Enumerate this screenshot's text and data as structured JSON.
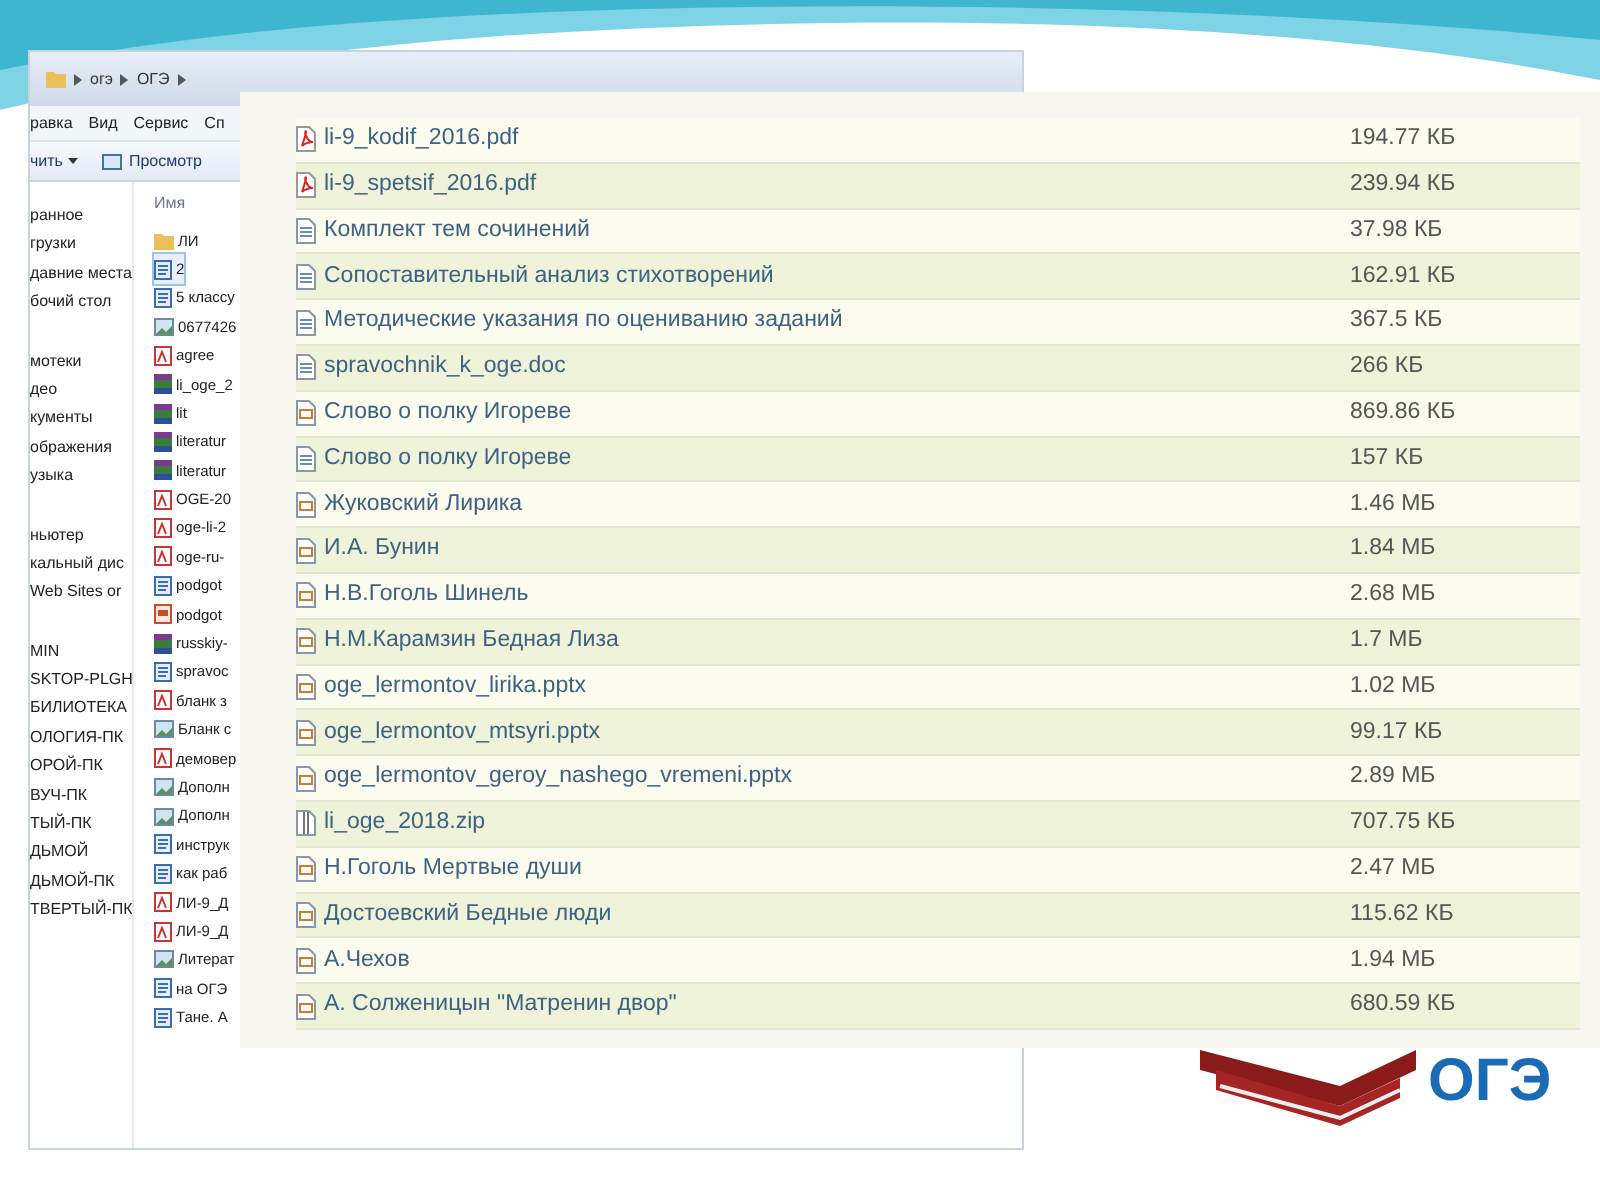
{
  "explorer": {
    "breadcrumbs": [
      "огэ",
      "ОГЭ"
    ],
    "menu": [
      "равка",
      "Вид",
      "Сервис",
      "Сп"
    ],
    "toolbar": [
      {
        "label": "чить",
        "kind": "dropdown"
      },
      {
        "label": "Просмотр",
        "kind": "preview"
      }
    ],
    "nav_groups": [
      [
        "ранное",
        "грузки",
        "давние места",
        "бочий стол"
      ],
      [
        "мотеки",
        "део",
        "кументы",
        "ображения",
        "узыка"
      ],
      [
        "ньютер",
        "кальный дис",
        "Web Sites or"
      ],
      [
        "MIN",
        "SKTOP-PLGH",
        "БИЛИОТЕКА",
        "ОЛОГИЯ-ПК",
        "ОРОЙ-ПК",
        "ВУЧ-ПК",
        "ТЫЙ-ПК",
        "ДЬМОЙ",
        "ДЬМОЙ-ПК",
        "ТВЕРТЫЙ-ПК"
      ]
    ],
    "column_header": "Имя",
    "files": [
      {
        "name": "ЛИ",
        "kind": "folder",
        "selected": false
      },
      {
        "name": "2",
        "kind": "doc",
        "selected": true
      },
      {
        "name": "5 классу",
        "kind": "doc",
        "selected": false
      },
      {
        "name": "0677426",
        "kind": "image",
        "selected": false
      },
      {
        "name": "agree",
        "kind": "pdf",
        "selected": false
      },
      {
        "name": "li_oge_2",
        "kind": "archive",
        "selected": false
      },
      {
        "name": "lit",
        "kind": "archive",
        "selected": false
      },
      {
        "name": "literatur",
        "kind": "archive",
        "selected": false
      },
      {
        "name": "literatur",
        "kind": "archive",
        "selected": false
      },
      {
        "name": "OGE-20",
        "kind": "pdf",
        "selected": false
      },
      {
        "name": "oge-li-2",
        "kind": "pdf",
        "selected": false
      },
      {
        "name": "oge-ru-",
        "kind": "pdf",
        "selected": false
      },
      {
        "name": "podgot",
        "kind": "doc",
        "selected": false
      },
      {
        "name": "podgot",
        "kind": "ppt",
        "selected": false
      },
      {
        "name": "russkiy-",
        "kind": "archive",
        "selected": false
      },
      {
        "name": "spravoc",
        "kind": "doc",
        "selected": false
      },
      {
        "name": "бланк з",
        "kind": "pdf",
        "selected": false
      },
      {
        "name": "Бланк с",
        "kind": "image",
        "selected": false
      },
      {
        "name": "демовер",
        "kind": "pdf",
        "selected": false
      },
      {
        "name": "Дополн",
        "kind": "image",
        "selected": false
      },
      {
        "name": "Дополн",
        "kind": "image",
        "selected": false
      },
      {
        "name": "инструк",
        "kind": "doc",
        "selected": false
      },
      {
        "name": "как раб",
        "kind": "doc",
        "selected": false
      },
      {
        "name": "ЛИ-9_Д",
        "kind": "pdf",
        "selected": false
      },
      {
        "name": "ЛИ-9_Д",
        "kind": "pdf",
        "selected": false
      },
      {
        "name": "Литерат",
        "kind": "image",
        "selected": false
      },
      {
        "name": "на ОГЭ",
        "kind": "doc",
        "selected": false
      },
      {
        "name": "Тане. А",
        "kind": "doc",
        "selected": false
      }
    ]
  },
  "file_table": {
    "rows": [
      {
        "name": "li-9_kodif_2016.pdf",
        "size": "194.77 КБ",
        "kind": "pdf"
      },
      {
        "name": "li-9_spetsif_2016.pdf",
        "size": "239.94 КБ",
        "kind": "pdf"
      },
      {
        "name": "Комплект тем сочинений",
        "size": "37.98 КБ",
        "kind": "doc"
      },
      {
        "name": "Сопоставительный анализ стихотворений",
        "size": "162.91 КБ",
        "kind": "doc"
      },
      {
        "name": "Методические указания по оцениванию заданий",
        "size": "367.5 КБ",
        "kind": "doc"
      },
      {
        "name": "spravochnik_k_oge.doc",
        "size": "266 КБ",
        "kind": "doc"
      },
      {
        "name": "Слово о полку Игореве",
        "size": "869.86 КБ",
        "kind": "ppt"
      },
      {
        "name": "Слово о полку Игореве",
        "size": "157 КБ",
        "kind": "doc"
      },
      {
        "name": "Жуковский Лирика",
        "size": "1.46 МБ",
        "kind": "ppt"
      },
      {
        "name": "И.А. Бунин",
        "size": "1.84 МБ",
        "kind": "ppt"
      },
      {
        "name": "Н.В.Гоголь Шинель",
        "size": "2.68 МБ",
        "kind": "ppt"
      },
      {
        "name": "Н.М.Карамзин Бедная Лиза",
        "size": "1.7 МБ",
        "kind": "ppt"
      },
      {
        "name": "oge_lermontov_lirika.pptx",
        "size": "1.02 МБ",
        "kind": "ppt"
      },
      {
        "name": "oge_lermontov_mtsyri.pptx",
        "size": "99.17 КБ",
        "kind": "ppt"
      },
      {
        "name": "oge_lermontov_geroy_nashego_vremeni.pptx",
        "size": "2.89 МБ",
        "kind": "ppt"
      },
      {
        "name": "li_oge_2018.zip",
        "size": "707.75 КБ",
        "kind": "zip"
      },
      {
        "name": "Н.Гоголь Мертвые души",
        "size": "2.47 МБ",
        "kind": "ppt"
      },
      {
        "name": "Достоевский Бедные люди",
        "size": "115.62 КБ",
        "kind": "ppt"
      },
      {
        "name": "А.Чехов",
        "size": "1.94 МБ",
        "kind": "ppt"
      },
      {
        "name": "А. Солженицын \"Матренин двор\"",
        "size": "680.59 КБ",
        "kind": "ppt"
      }
    ]
  },
  "logo": {
    "text": "ОГЭ"
  }
}
